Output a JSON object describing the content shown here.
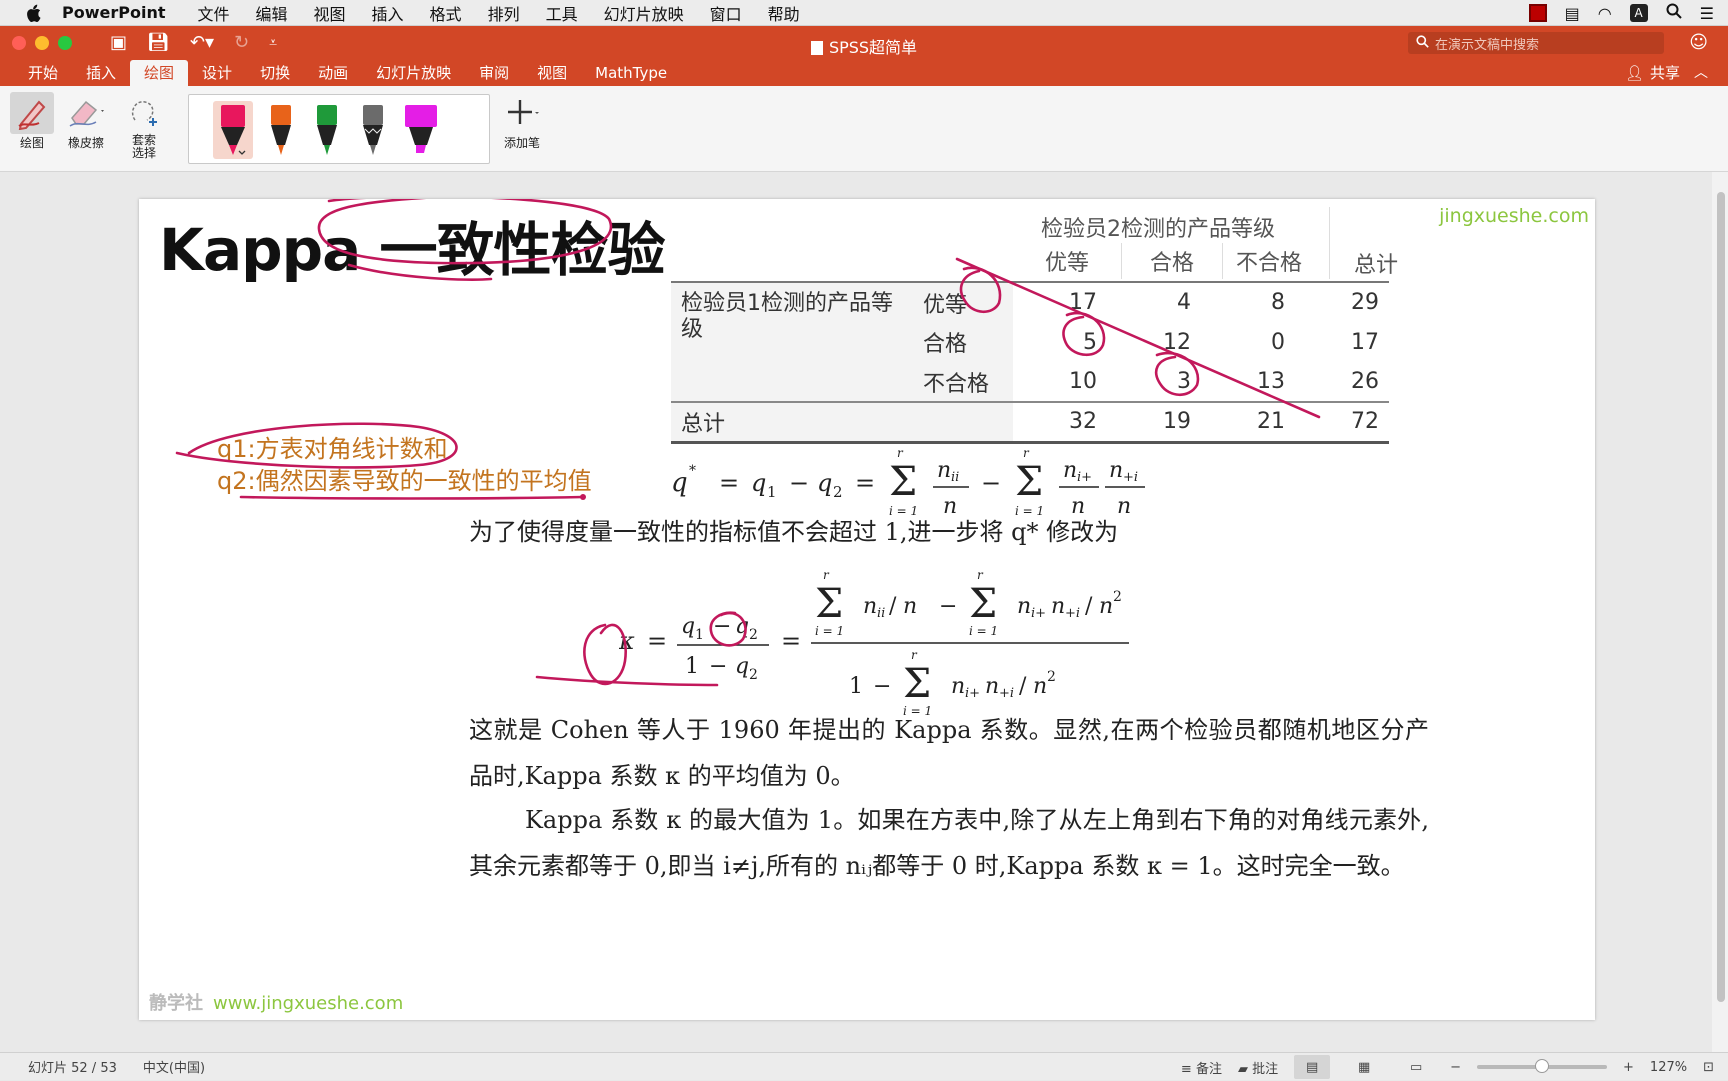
{
  "menubar": {
    "app": "PowerPoint",
    "items": [
      "文件",
      "编辑",
      "视图",
      "插入",
      "格式",
      "排列",
      "工具",
      "幻灯片放映",
      "窗口",
      "帮助"
    ]
  },
  "window": {
    "title": "SPSS超简单",
    "search_placeholder": "在演示文稿中搜索"
  },
  "ribbon_tabs": [
    "开始",
    "插入",
    "绘图",
    "设计",
    "切换",
    "动画",
    "幻灯片放映",
    "审阅",
    "视图",
    "MathType"
  ],
  "active_tab": "绘图",
  "share_label": "共享",
  "ribbon": {
    "draw_label": "绘图",
    "eraser_label": "橡皮擦",
    "lasso_label": "套索\n选择",
    "add_pen_label": "添加笔",
    "pen_colors": [
      "#e8175d",
      "#e8631a",
      "#1f9a3a",
      "#6b6b6b",
      "#e41ee6"
    ]
  },
  "slide": {
    "title_left": "Kappa ",
    "title_right": "一致性检验",
    "watermark_top": "jingxueshe.com",
    "watermark_bottom_brand": "静学社",
    "watermark_bottom_url": "www.jingxueshe.com",
    "table": {
      "col_group": "检验员2检测的产品等级",
      "columns": [
        "优等",
        "合格",
        "不合格",
        "总计"
      ],
      "row_group": "检验员1检测的产品等级",
      "rows": [
        {
          "label": "优等",
          "values": [
            "17",
            "4",
            "8",
            "29"
          ]
        },
        {
          "label": "合格",
          "values": [
            "5",
            "12",
            "0",
            "17"
          ]
        },
        {
          "label": "不合格",
          "values": [
            "10",
            "3",
            "13",
            "26"
          ]
        }
      ],
      "total_label": "总计",
      "totals": [
        "32",
        "19",
        "21",
        "72"
      ]
    },
    "note_q1": "q1:方表对角线计数和",
    "note_q2": "q2:偶然因素导致的一致性的平均值",
    "para1": "为了使得度量一致性的指标值不会超过 1,进一步将 q* 修改为",
    "para2": "这就是 Cohen 等人于 1960 年提出的 Kappa 系数。显然,在两个检验员都随机地区分产品时,Kappa 系数 κ 的平均值为 0。",
    "para3": "Kappa 系数 κ 的最大值为 1。如果在方表中,除了从左上角到右下角的对角线元素外,其余元素都等于 0,即当 i≠j,所有的 nᵢⱼ都等于 0 时,Kappa 系数 κ = 1。这时完全一致。"
  },
  "status": {
    "slide_info": "幻灯片 52 / 53",
    "language": "中文(中国)",
    "notes": "备注",
    "comments": "批注",
    "zoom": "127%"
  }
}
